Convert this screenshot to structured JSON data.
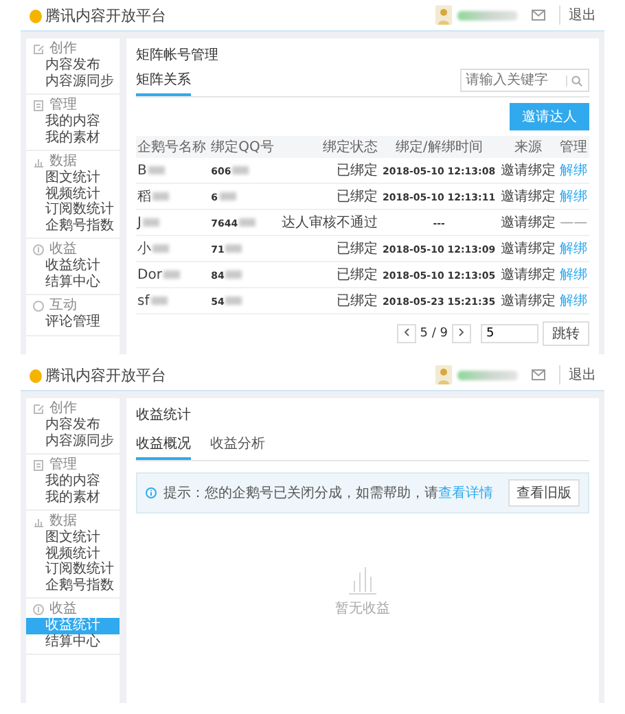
{
  "screens": [
    {
      "kind": "account-matrix",
      "header": {
        "logo_text": "腾讯内容开放平台",
        "logout": "退出"
      },
      "sidebar": [
        {
          "title": "创作",
          "items": [
            {
              "label": "内容发布",
              "selected": false
            },
            {
              "label": "内容源同步",
              "selected": false
            }
          ]
        },
        {
          "title": "管理",
          "items": [
            {
              "label": "我的内容",
              "selected": false
            },
            {
              "label": "我的素材",
              "selected": false
            }
          ]
        },
        {
          "title": "数据",
          "items": [
            {
              "label": "图文统计",
              "selected": false
            },
            {
              "label": "视频统计",
              "selected": false
            },
            {
              "label": "订阅数统计",
              "selected": false
            },
            {
              "label": "企鹅号指数",
              "selected": false
            }
          ]
        },
        {
          "title": "收益",
          "items": [
            {
              "label": "收益统计",
              "selected": false
            },
            {
              "label": "结算中心",
              "selected": false
            }
          ]
        },
        {
          "title": "互动",
          "items": [
            {
              "label": "评论管理",
              "selected": false
            }
          ]
        }
      ],
      "main": {
        "title": "矩阵帐号管理",
        "tabs": [
          {
            "label": "矩阵关系",
            "selected": true
          }
        ],
        "search": {
          "placeholder": "请输入关键字"
        },
        "invite_button": "邀请达人",
        "table": {
          "columns": [
            "企鹅号名称",
            "绑定QQ号",
            "绑定状态",
            "绑定/解绑时间",
            "来源",
            "管理"
          ],
          "rows": [
            {
              "name": "B",
              "qq": "606",
              "status": "已绑定",
              "time": "2018-05-10 12:13:08",
              "source": "邀请绑定",
              "action": "解绑",
              "action_enabled": true
            },
            {
              "name": "稻",
              "qq": "6",
              "status": "已绑定",
              "time": "2018-05-10 12:13:11",
              "source": "邀请绑定",
              "action": "解绑",
              "action_enabled": true
            },
            {
              "name": "J",
              "qq": "7644",
              "status": "达人审核不通过",
              "time": "---",
              "source": "邀请绑定",
              "action": "——",
              "action_enabled": false
            },
            {
              "name": "小",
              "qq": "71",
              "status": "已绑定",
              "time": "2018-05-10 12:13:09",
              "source": "邀请绑定",
              "action": "解绑",
              "action_enabled": true
            },
            {
              "name": "Dor",
              "qq": "84",
              "status": "已绑定",
              "time": "2018-05-10 12:13:05",
              "source": "邀请绑定",
              "action": "解绑",
              "action_enabled": true
            },
            {
              "name": "sf",
              "qq": "54",
              "status": "已绑定",
              "time": "2018-05-23 15:21:35",
              "source": "邀请绑定",
              "action": "解绑",
              "action_enabled": true
            }
          ]
        },
        "pagination": {
          "page_status": "5 / 9",
          "page_input": "5",
          "jump_button": "跳转"
        }
      }
    },
    {
      "kind": "revenue",
      "header": {
        "logo_text": "腾讯内容开放平台",
        "logout": "退出"
      },
      "sidebar": [
        {
          "title": "创作",
          "items": [
            {
              "label": "内容发布",
              "selected": false
            },
            {
              "label": "内容源同步",
              "selected": false
            }
          ]
        },
        {
          "title": "管理",
          "items": [
            {
              "label": "我的内容",
              "selected": false
            },
            {
              "label": "我的素材",
              "selected": false
            }
          ]
        },
        {
          "title": "数据",
          "items": [
            {
              "label": "图文统计",
              "selected": false
            },
            {
              "label": "视频统计",
              "selected": false
            },
            {
              "label": "订阅数统计",
              "selected": false
            },
            {
              "label": "企鹅号指数",
              "selected": false
            }
          ]
        },
        {
          "title": "收益",
          "items": [
            {
              "label": "收益统计",
              "selected": true
            },
            {
              "label": "结算中心",
              "selected": false
            }
          ]
        }
      ],
      "main": {
        "title": "收益统计",
        "tabs": [
          {
            "label": "收益概况",
            "selected": true
          },
          {
            "label": "收益分析",
            "selected": false
          }
        ],
        "notice": {
          "text": "提示：您的企鹅号已关闭分成，如需帮助，请",
          "link": "查看详情"
        },
        "old_version_button": "查看旧版",
        "empty_text": "暂无收益"
      }
    }
  ]
}
